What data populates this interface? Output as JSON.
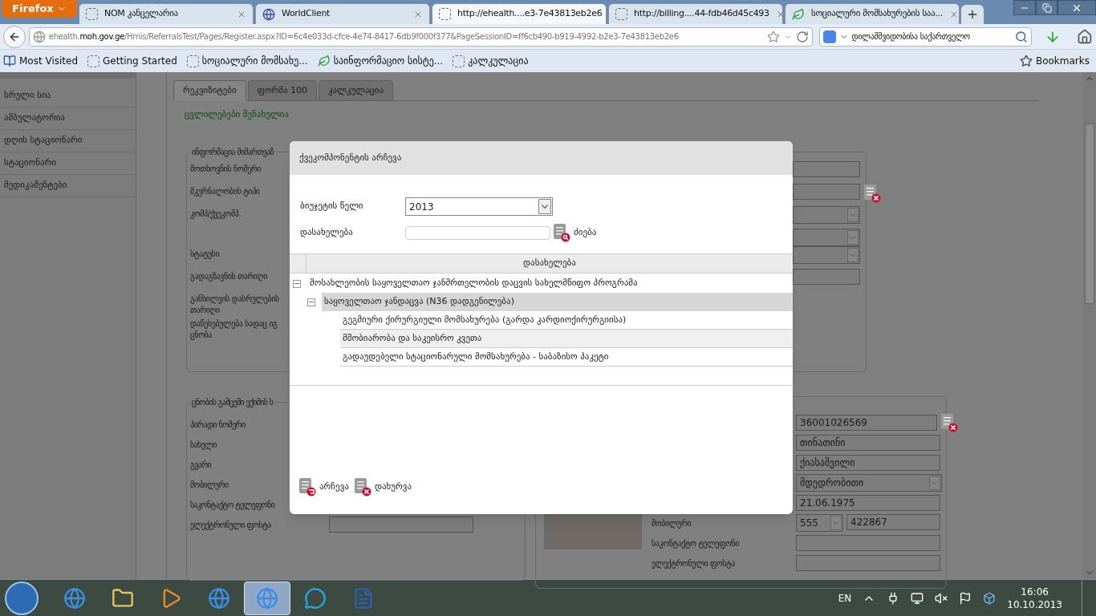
{
  "browser": {
    "menu_button": "Firefox",
    "tabs": [
      {
        "title": "NOM კანცელარია",
        "selected": false
      },
      {
        "title": "WorldClient",
        "selected": false
      },
      {
        "title": "http://ehealth....e3-7e43813eb2e6",
        "selected": true
      },
      {
        "title": "http://billing....44-fdb46d45c493",
        "selected": false
      },
      {
        "title": "სოციალური მომსახურების საა...",
        "selected": false
      }
    ],
    "url": "ehealth.**moh.gov.ge**/Hmis/ReferralsTest/Pages/Register.aspx?ID=6c4e033d-cfce-4e74-8417-6db9f000f377&PageSessionID=ff6cb490-b919-4992-b2e3-7e43813eb2e6",
    "search": "დილამშვიდობისა საქართველო",
    "bookmarks": [
      "Most Visited",
      "Getting Started",
      "სოციალური მომსახუ...",
      "საინფორმაციო სისტე...",
      "კალკულაცია"
    ],
    "bookmarks_menu": "Bookmarks"
  },
  "sidebar": {
    "items": [
      "სრული სია",
      "ამბულატორია",
      "დღის სტაციონარი",
      "სტაციონარი",
      "მედიკამენტები"
    ]
  },
  "page_tabs": [
    {
      "label": "რეკვიზიტები",
      "selected": true
    },
    {
      "label": "ფორმა 100",
      "selected": false
    },
    {
      "label": "კალკულაცია",
      "selected": false
    }
  ],
  "status_message": "ცვლილებები შენახულია",
  "referral_info": {
    "legend": "ინფორმაცია მიმართვაზ",
    "rows": [
      {
        "label": "მოთხოვნის ნომერი",
        "kind": "input"
      },
      {
        "label": "მკურნალობის ტიპი",
        "kind": "lookup"
      },
      {
        "label": "კომპ/ქვეკომპ.",
        "kind": "select_pair"
      },
      {
        "label": "სტატუსი",
        "kind": "select"
      },
      {
        "label": "გადაგზავნის თარიღი",
        "kind": "input"
      },
      {
        "label": "განხილვის დასრულების თარიღი",
        "kind": "none"
      },
      {
        "label": "დაწესებულება სადაც იგ ცნობა",
        "kind": "none"
      }
    ]
  },
  "doctor_info": {
    "legend": "ცნობის გამცემი ექიმის ს",
    "rows": [
      "პირადი ნომერი",
      "სახელი",
      "გვარი",
      "მობილური",
      "საკონტაქტო ტელეფონი",
      "ელექტრონული ფოსტა"
    ]
  },
  "patient_panel": {
    "rows": [
      {
        "kind": "lookup",
        "value": "36001026569"
      },
      {
        "kind": "input",
        "value": "თინათინი"
      },
      {
        "kind": "input",
        "value": "ქიასაშვილი"
      },
      {
        "kind": "select",
        "value": "მდედრობითი"
      },
      {
        "kind": "input",
        "value": "21.06.1975"
      },
      {
        "kind": "phone",
        "label": "მობილური",
        "code": "555",
        "value": "422867"
      },
      {
        "kind": "input",
        "label": "საკონტაქტო ტელეფონი"
      },
      {
        "kind": "input",
        "label": "ელექტრონული ფოსტა"
      }
    ]
  },
  "dialog": {
    "title": "ქვეკომპონენტის არჩევა",
    "budget_year_label": "ბიუჯეტის წელი",
    "budget_year": "2013",
    "name_label": "დასახელება",
    "search_button": "ძიება",
    "grid_column": "დასახელება",
    "tree": [
      {
        "label": "მოსახლეობის საყოველთაო ჯანმრთელობის დაცვის სახელმწიფო პროგრამა",
        "expanded": true,
        "selected": false,
        "children": [
          {
            "label": "საყოველთაო ჯანდაცვა (N36 დადგენილება)",
            "expanded": true,
            "selected": true,
            "children": [
              {
                "label": "გეგმიური ქირურგიული მომსახურება (გარდა კარდიოქირურგიისა)",
                "selected": false
              },
              {
                "label": "მშობიარობა და საკეისრო კვეთა",
                "selected": false
              },
              {
                "label": "გადაუდებელი სტაციონარული მომსახურება - საბაზისო პაკეტი",
                "selected": false
              }
            ]
          }
        ]
      }
    ],
    "buttons": [
      {
        "label": "არჩევა",
        "kind": "select"
      },
      {
        "label": "დახურვა",
        "kind": "close"
      }
    ]
  },
  "taskbar": {
    "apps": [
      {
        "kind": "browser",
        "active": false
      },
      {
        "kind": "folder",
        "active": false
      },
      {
        "kind": "media",
        "active": false
      },
      {
        "kind": "browser",
        "active": false
      },
      {
        "kind": "browser",
        "active": true
      },
      {
        "kind": "chat",
        "active": false
      },
      {
        "kind": "document",
        "active": false
      }
    ],
    "language": "EN",
    "time": "16:06",
    "date": "10.10.2013"
  }
}
